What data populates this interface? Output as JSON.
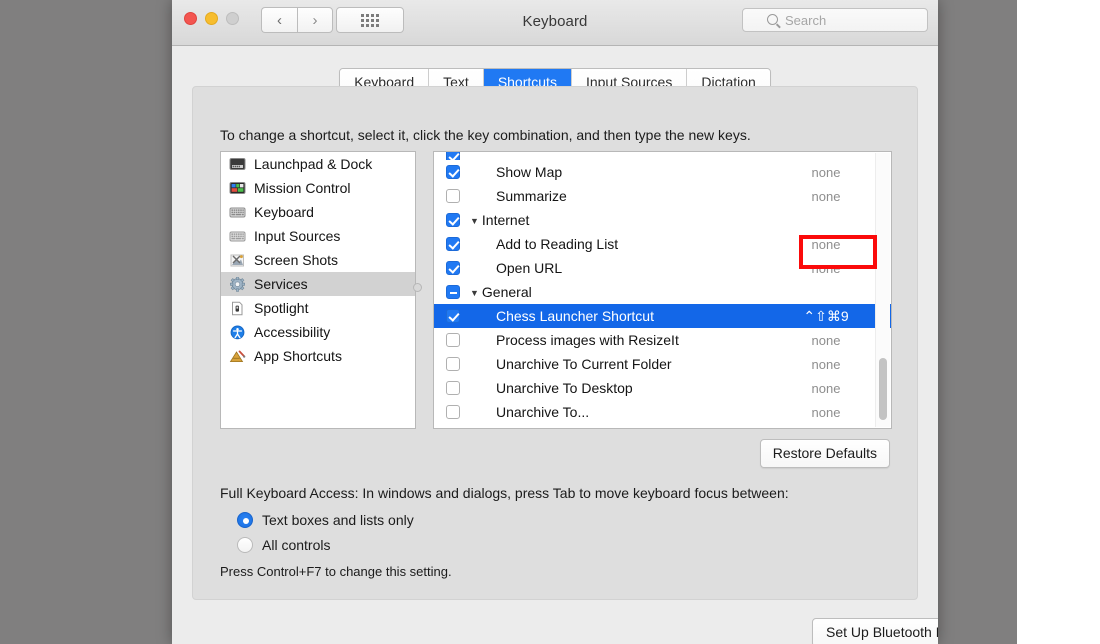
{
  "window": {
    "title": "Keyboard",
    "traffic_lights": [
      "close",
      "minimize",
      "zoom"
    ],
    "nav_back": "‹",
    "nav_forward": "›",
    "grid_button": "show-all-icon",
    "search": {
      "placeholder": "Search",
      "value": "",
      "icon": "search-icon"
    }
  },
  "tabs": [
    {
      "label": "Keyboard",
      "active": false
    },
    {
      "label": "Text",
      "active": false
    },
    {
      "label": "Shortcuts",
      "active": true
    },
    {
      "label": "Input Sources",
      "active": false
    },
    {
      "label": "Dictation",
      "active": false
    }
  ],
  "hint": "To change a shortcut, select it, click the key combination, and then type the new keys.",
  "sidebar": {
    "items": [
      {
        "label": "Launchpad & Dock",
        "icon": "launchpad-dock-icon",
        "selected": false
      },
      {
        "label": "Mission Control",
        "icon": "mission-control-icon",
        "selected": false
      },
      {
        "label": "Keyboard",
        "icon": "keyboard-icon",
        "selected": false
      },
      {
        "label": "Input Sources",
        "icon": "input-sources-icon",
        "selected": false
      },
      {
        "label": "Screen Shots",
        "icon": "screen-shots-icon",
        "selected": false
      },
      {
        "label": "Services",
        "icon": "services-gear-icon",
        "selected": true
      },
      {
        "label": "Spotlight",
        "icon": "spotlight-icon",
        "selected": false
      },
      {
        "label": "Accessibility",
        "icon": "accessibility-icon",
        "selected": false
      },
      {
        "label": "App Shortcuts",
        "icon": "app-shortcuts-icon",
        "selected": false
      }
    ]
  },
  "shortcuts": {
    "rows": [
      {
        "label": "",
        "shortcut": "",
        "checkbox": "checked",
        "kind": "clipped",
        "selected": false
      },
      {
        "label": "Show Map",
        "shortcut": "none",
        "checkbox": "checked",
        "kind": "item",
        "selected": false
      },
      {
        "label": "Summarize",
        "shortcut": "none",
        "checkbox": "unchecked",
        "kind": "item",
        "selected": false
      },
      {
        "label": "Internet",
        "shortcut": "",
        "checkbox": "checked",
        "kind": "group",
        "selected": false
      },
      {
        "label": "Add to Reading List",
        "shortcut": "none",
        "checkbox": "checked",
        "kind": "item",
        "selected": false
      },
      {
        "label": "Open URL",
        "shortcut": "none",
        "checkbox": "checked",
        "kind": "item",
        "selected": false
      },
      {
        "label": "General",
        "shortcut": "",
        "checkbox": "mixed",
        "kind": "group",
        "selected": false
      },
      {
        "label": "Chess Launcher Shortcut",
        "shortcut": "⌃⇧⌘9",
        "checkbox": "checked",
        "kind": "item",
        "selected": true
      },
      {
        "label": "Process images with ResizeIt",
        "shortcut": "none",
        "checkbox": "unchecked",
        "kind": "item",
        "selected": false
      },
      {
        "label": "Unarchive To Current Folder",
        "shortcut": "none",
        "checkbox": "unchecked",
        "kind": "item",
        "selected": false
      },
      {
        "label": "Unarchive To Desktop",
        "shortcut": "none",
        "checkbox": "unchecked",
        "kind": "item",
        "selected": false
      },
      {
        "label": "Unarchive To...",
        "shortcut": "none",
        "checkbox": "unchecked",
        "kind": "item",
        "selected": false
      }
    ],
    "disclosure_triangle": "▼",
    "annotation_color": "#fb0a0a"
  },
  "restore_defaults_label": "Restore Defaults",
  "full_keyboard_access": {
    "label": "Full Keyboard Access: In windows and dialogs, press Tab to move keyboard focus between:",
    "options": [
      {
        "label": "Text boxes and lists only",
        "selected": true
      },
      {
        "label": "All controls",
        "selected": false
      }
    ],
    "note": "Press Control+F7 to change this setting."
  },
  "footer": {
    "bluetooth_label": "Set Up Bluetooth Keyboard...",
    "help_label": "?"
  }
}
